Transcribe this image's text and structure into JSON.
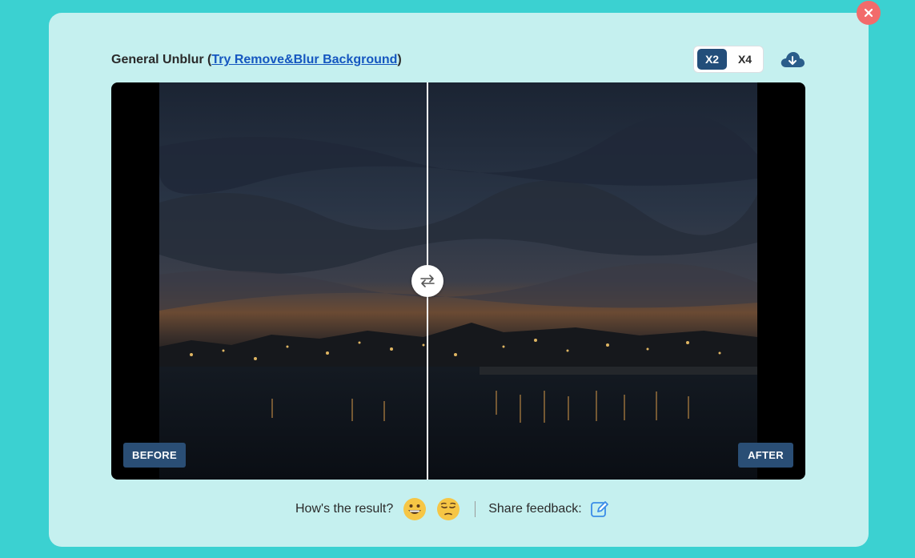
{
  "title": {
    "prefix": "General Unblur (",
    "link": "Try Remove&Blur Background",
    "suffix": ")"
  },
  "scale": {
    "options": [
      "X2",
      "X4"
    ],
    "selected": "X2"
  },
  "icons": {
    "close": "close-icon",
    "download": "cloud-download-icon",
    "swap": "swap-arrows-icon",
    "happy": "grinning-face-icon",
    "sad": "pensive-face-icon",
    "edit": "edit-icon"
  },
  "comparison": {
    "before_label": "BEFORE",
    "after_label": "AFTER"
  },
  "feedback": {
    "question": "How's the result?",
    "share_label": "Share feedback:"
  },
  "colors": {
    "page_bg": "#3bd1d1",
    "modal_bg": "#c5f0ef",
    "accent": "#234e7a",
    "close": "#f26b6b",
    "link": "#1557c0"
  }
}
